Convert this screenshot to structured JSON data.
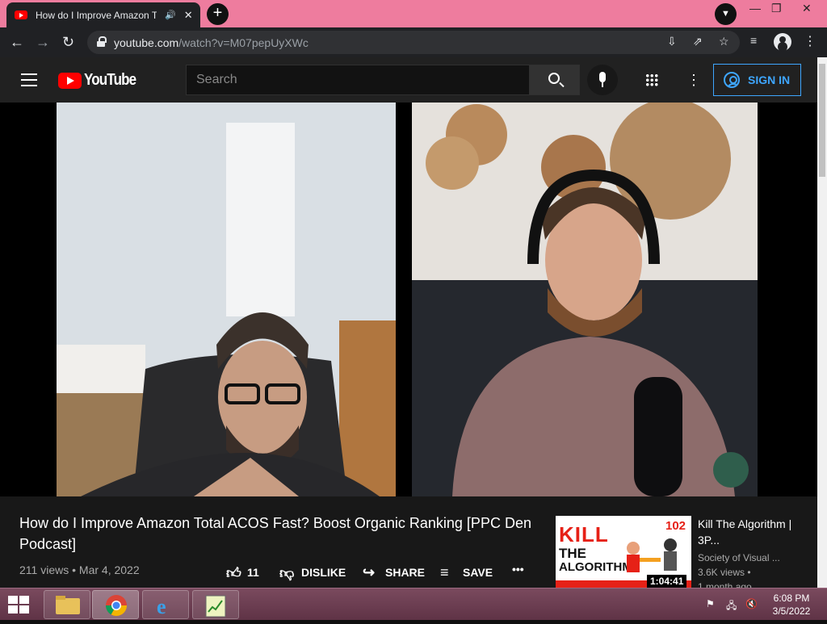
{
  "browser": {
    "tab_title": "How do I Improve Amazon T",
    "new_tab_label": "+",
    "url_host": "youtube.com",
    "url_path": "/watch?v=M07pepUyXWc",
    "window_controls": {
      "minimize": "—",
      "restore": "❐",
      "close": "✕"
    }
  },
  "youtube": {
    "logo_text": "YouTube",
    "search_placeholder": "Search",
    "sign_in_label": "SIGN IN",
    "more_label": "⋮"
  },
  "video": {
    "title": "How do I Improve Amazon Total ACOS Fast? Boost Organic Ranking [PPC Den Podcast]",
    "views": "211 views",
    "separator": "•",
    "date": "Mar 4, 2022",
    "likes": "11",
    "dislike_label": "DISLIKE",
    "share_label": "SHARE",
    "save_label": "SAVE",
    "more_label": "•••"
  },
  "related": {
    "thumb_kill": "KILL",
    "thumb_the": "THE",
    "thumb_algorithm": "ALGORITHM",
    "thumb_number": "102",
    "duration": "1:04:41",
    "title": "Kill The Algorithm | 3P...",
    "channel": "Society of Visual ...",
    "views": "3.6K views •",
    "age": "1 month ago"
  },
  "taskbar": {
    "time": "6:08 PM",
    "date": "3/5/2022"
  },
  "colors": {
    "tab_strip": "#ee7c9e",
    "yt_red": "#ff0000",
    "sign_in_blue": "#3ea6ff",
    "taskbar": "#6b3c50"
  }
}
